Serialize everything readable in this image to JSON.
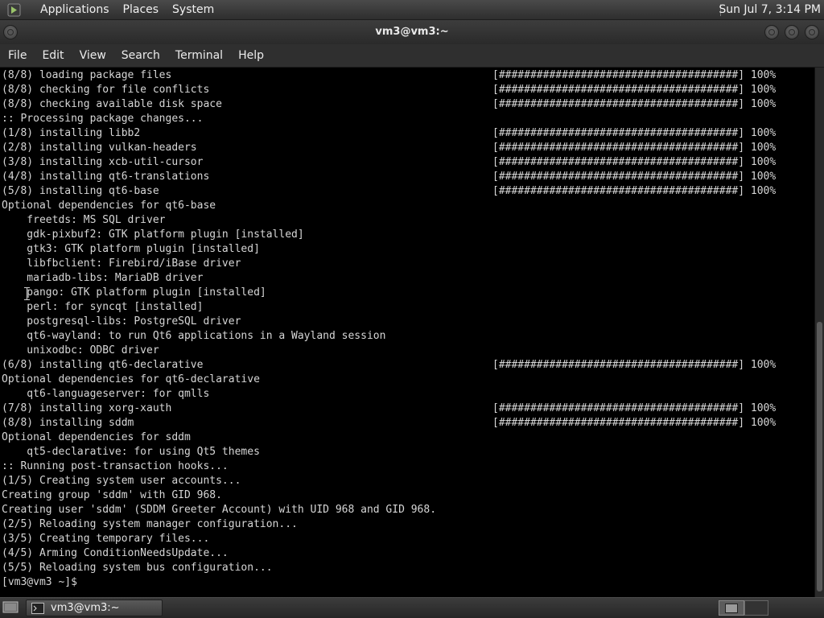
{
  "top_panel": {
    "menus": [
      "Applications",
      "Places",
      "System"
    ],
    "clock": "Sun Jul 7,  3:14 PM"
  },
  "window": {
    "title": "vm3@vm3:~"
  },
  "menubar": [
    "File",
    "Edit",
    "View",
    "Search",
    "Terminal",
    "Help"
  ],
  "terminal": {
    "lines": [
      {
        "text": "(8/8) loading package files",
        "progress": "[######################################] 100%"
      },
      {
        "text": "(8/8) checking for file conflicts",
        "progress": "[######################################] 100%"
      },
      {
        "text": "(8/8) checking available disk space",
        "progress": "[######################################] 100%"
      },
      {
        "text": ":: Processing package changes...",
        "progress": ""
      },
      {
        "text": "(1/8) installing libb2",
        "progress": "[######################################] 100%"
      },
      {
        "text": "(2/8) installing vulkan-headers",
        "progress": "[######################################] 100%"
      },
      {
        "text": "(3/8) installing xcb-util-cursor",
        "progress": "[######################################] 100%"
      },
      {
        "text": "(4/8) installing qt6-translations",
        "progress": "[######################################] 100%"
      },
      {
        "text": "(5/8) installing qt6-base",
        "progress": "[######################################] 100%"
      },
      {
        "text": "Optional dependencies for qt6-base",
        "progress": ""
      },
      {
        "text": "    freetds: MS SQL driver",
        "progress": ""
      },
      {
        "text": "    gdk-pixbuf2: GTK platform plugin [installed]",
        "progress": ""
      },
      {
        "text": "    gtk3: GTK platform plugin [installed]",
        "progress": ""
      },
      {
        "text": "    libfbclient: Firebird/iBase driver",
        "progress": ""
      },
      {
        "text": "    mariadb-libs: MariaDB driver",
        "progress": ""
      },
      {
        "text": "    pango: GTK platform plugin [installed]",
        "progress": ""
      },
      {
        "text": "    perl: for syncqt [installed]",
        "progress": ""
      },
      {
        "text": "    postgresql-libs: PostgreSQL driver",
        "progress": ""
      },
      {
        "text": "    qt6-wayland: to run Qt6 applications in a Wayland session",
        "progress": ""
      },
      {
        "text": "    unixodbc: ODBC driver",
        "progress": ""
      },
      {
        "text": "(6/8) installing qt6-declarative",
        "progress": "[######################################] 100%"
      },
      {
        "text": "Optional dependencies for qt6-declarative",
        "progress": ""
      },
      {
        "text": "    qt6-languageserver: for qmlls",
        "progress": ""
      },
      {
        "text": "(7/8) installing xorg-xauth",
        "progress": "[######################################] 100%"
      },
      {
        "text": "(8/8) installing sddm",
        "progress": "[######################################] 100%"
      },
      {
        "text": "Optional dependencies for sddm",
        "progress": ""
      },
      {
        "text": "    qt5-declarative: for using Qt5 themes",
        "progress": ""
      },
      {
        "text": ":: Running post-transaction hooks...",
        "progress": ""
      },
      {
        "text": "(1/5) Creating system user accounts...",
        "progress": ""
      },
      {
        "text": "Creating group 'sddm' with GID 968.",
        "progress": ""
      },
      {
        "text": "Creating user 'sddm' (SDDM Greeter Account) with UID 968 and GID 968.",
        "progress": ""
      },
      {
        "text": "(2/5) Reloading system manager configuration...",
        "progress": ""
      },
      {
        "text": "(3/5) Creating temporary files...",
        "progress": ""
      },
      {
        "text": "(4/5) Arming ConditionNeedsUpdate...",
        "progress": ""
      },
      {
        "text": "(5/5) Reloading system bus configuration...",
        "progress": ""
      },
      {
        "text": "[vm3@vm3 ~]$ ",
        "progress": ""
      }
    ]
  },
  "taskbar": {
    "task_label": "vm3@vm3:~"
  },
  "icons": {
    "apps": "gnome-foot-icon",
    "terminal": "terminal-icon",
    "desktop": "show-desktop-icon"
  }
}
